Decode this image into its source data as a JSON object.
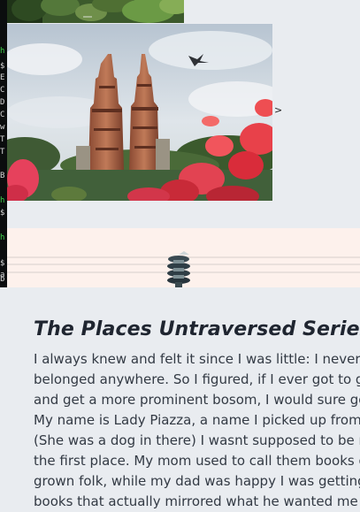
{
  "terminal": {
    "lines": [
      {
        "text": "h",
        "color": "green"
      },
      {
        "text": "$",
        "color": "white"
      },
      {
        "text": "E",
        "color": "white"
      },
      {
        "text": "C",
        "color": "white"
      },
      {
        "text": "D",
        "color": "white"
      },
      {
        "text": "C",
        "color": "white"
      },
      {
        "text": "w",
        "color": "white"
      },
      {
        "text": "T",
        "color": "white"
      },
      {
        "text": "T",
        "color": "white"
      },
      {
        "text": "B",
        "color": "white"
      },
      {
        "text": "h",
        "color": "green"
      },
      {
        "text": "$",
        "color": "white"
      },
      {
        "text": "h",
        "color": "green"
      },
      {
        "text": "$",
        "color": "white"
      },
      {
        "text": "a",
        "color": "white"
      },
      {
        "text": "b",
        "color": "white"
      },
      {
        "text": "h",
        "color": "green"
      },
      {
        "text": "$",
        "color": "white"
      },
      {
        "text": "E",
        "color": "white"
      },
      {
        "text": "h",
        "color": "green"
      },
      {
        "text": "$",
        "color": "white"
      },
      {
        "text": "h",
        "color": "green"
      },
      {
        "text": "$",
        "color": "white"
      },
      {
        "text": "a",
        "color": "white"
      },
      {
        "text": "b",
        "color": "white"
      },
      {
        "text": "h",
        "color": "green"
      },
      {
        "text": "$",
        "color": "white"
      },
      {
        "text": "E",
        "color": "white"
      },
      {
        "text": "h",
        "color": "green"
      }
    ]
  },
  "carousel": {
    "next_label": ">"
  },
  "article": {
    "title": "The Places Untraversed Series",
    "lines": [
      "I always knew and felt it since I was little: I never really",
      "belonged anywhere. So I figured, if I ever got to grow up",
      "and get a more prominent bosom, I would sure go places.",
      "My name is Lady Piazza, a name I picked up from a novel.",
      "(She was a dog in there) I wasnt supposed to be reading it in",
      "the first place. My mom used to call them books of the",
      "grown folk, while my dad was happy I was getting into",
      "books that actually mirrored what he wanted me to be."
    ]
  },
  "colors": {
    "terminal_bg": "#0b0d0e",
    "terminal_green": "#3fd24b",
    "page_bg": "#e9ecf0",
    "banner_bg": "#fdf1ec",
    "title_color": "#1f2530",
    "text_color": "#333a44"
  }
}
